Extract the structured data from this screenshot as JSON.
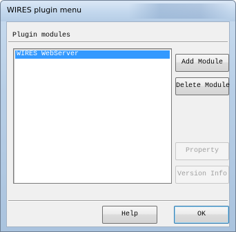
{
  "window": {
    "title": "WIRES plugin menu"
  },
  "modules": {
    "label": "Plugin modules",
    "items": [
      "WIRES WebServer"
    ],
    "selected_index": 0
  },
  "buttons": {
    "add": "Add Module",
    "delete": "Delete Module",
    "property": "Property",
    "version": "Version Info",
    "help": "Help",
    "ok": "OK"
  },
  "colors": {
    "selection": "#3399ff",
    "disabled_text": "#a0a0a0"
  }
}
